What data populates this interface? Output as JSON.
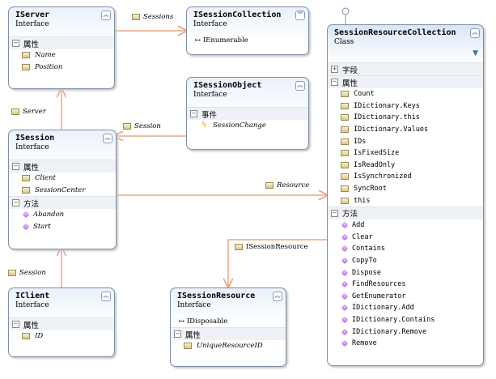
{
  "boxes": {
    "iserver": {
      "title": "IServer",
      "kind": "Interface",
      "sections": [
        {
          "label": "属性",
          "items": [
            "Name",
            "Position"
          ]
        }
      ]
    },
    "isessioncollection": {
      "title": "ISessionCollection",
      "kind": "Interface",
      "extra": "IEnumerable"
    },
    "isessionobject": {
      "title": "ISessionObject",
      "kind": "Interface",
      "sections": [
        {
          "label": "事件",
          "items": [
            "SessionChange"
          ]
        }
      ]
    },
    "isession": {
      "title": "ISession",
      "kind": "Interface",
      "sections": [
        {
          "label": "属性",
          "items": [
            "Client",
            "SessionCenter"
          ]
        },
        {
          "label": "方法",
          "items": [
            "Abandon",
            "Start"
          ]
        }
      ]
    },
    "iclient": {
      "title": "IClient",
      "kind": "Interface",
      "sections": [
        {
          "label": "属性",
          "items": [
            "ID"
          ]
        }
      ]
    },
    "isessionresource": {
      "title": "ISessionResource",
      "kind": "Interface",
      "extra": "IDisposable",
      "sections": [
        {
          "label": "属性",
          "items": [
            "UniqueResourceID"
          ]
        }
      ]
    },
    "sessionresourcecollection": {
      "title": "SessionResourceCollection",
      "kind": "Class",
      "sections": [
        {
          "label": "字段",
          "collapsed": true,
          "items": []
        },
        {
          "label": "属性",
          "items": [
            "Count",
            "IDictionary.Keys",
            "IDictionary.this",
            "IDictionary.Values",
            "IDs",
            "IsFixedSize",
            "IsReadOnly",
            "IsSynchronized",
            "SyncRoot",
            "this"
          ]
        },
        {
          "label": "方法",
          "items": [
            "Add",
            "Clear",
            "Contains",
            "CopyTo",
            "Dispose",
            "FindResources",
            "GetEnumerator",
            "IDictionary.Add",
            "IDictionary.Contains",
            "IDictionary.Remove",
            "Remove"
          ]
        }
      ]
    }
  },
  "links": {
    "sessions": "Sessions",
    "server": "Server",
    "session_obj": "Session",
    "resource": "Resource",
    "session_client": "Session",
    "isessionresource": "ISessionResource"
  },
  "icons": {
    "collapse": "double-chevron-icon",
    "property": "property-icon",
    "method": "method-icon",
    "event": "lightning-icon"
  },
  "colors": {
    "connector": "#e8a888",
    "border": "#7f8ea3"
  }
}
